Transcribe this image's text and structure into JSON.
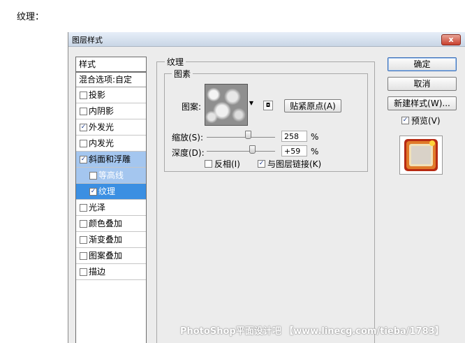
{
  "page": {
    "heading": "纹理："
  },
  "dialog": {
    "title": "图层样式",
    "close_label": "x",
    "style_list": {
      "header": "样式",
      "blend_options": "混合选项:自定",
      "items": [
        {
          "label": "投影",
          "checked": false
        },
        {
          "label": "内阴影",
          "checked": false
        },
        {
          "label": "外发光",
          "checked": true
        },
        {
          "label": "内发光",
          "checked": false
        },
        {
          "label": "斜面和浮雕",
          "checked": true
        },
        {
          "label": "等高线",
          "checked": false
        },
        {
          "label": "纹理",
          "checked": true
        },
        {
          "label": "光泽",
          "checked": false
        },
        {
          "label": "颜色叠加",
          "checked": false
        },
        {
          "label": "渐变叠加",
          "checked": false
        },
        {
          "label": "图案叠加",
          "checked": false
        },
        {
          "label": "描边",
          "checked": false
        }
      ]
    },
    "texture": {
      "section_title": "纹理",
      "group_title": "图素",
      "pattern_label": "图案:",
      "snap_button": "贴紧原点(A)",
      "scale_label": "缩放(S):",
      "scale_value": "258",
      "scale_unit": "%",
      "depth_label": "深度(D):",
      "depth_value": "+59",
      "depth_unit": "%",
      "invert_label": "反相(I)",
      "invert_checked": false,
      "link_label": "与图层链接(K)",
      "link_checked": true
    },
    "buttons": {
      "ok": "确定",
      "cancel": "取消",
      "new_style": "新建样式(W)...",
      "preview_label": "预览(V)",
      "preview_checked": true
    }
  },
  "watermark": "PhotoShop平面设计吧 【www.linecg.com/tieba/1783】"
}
